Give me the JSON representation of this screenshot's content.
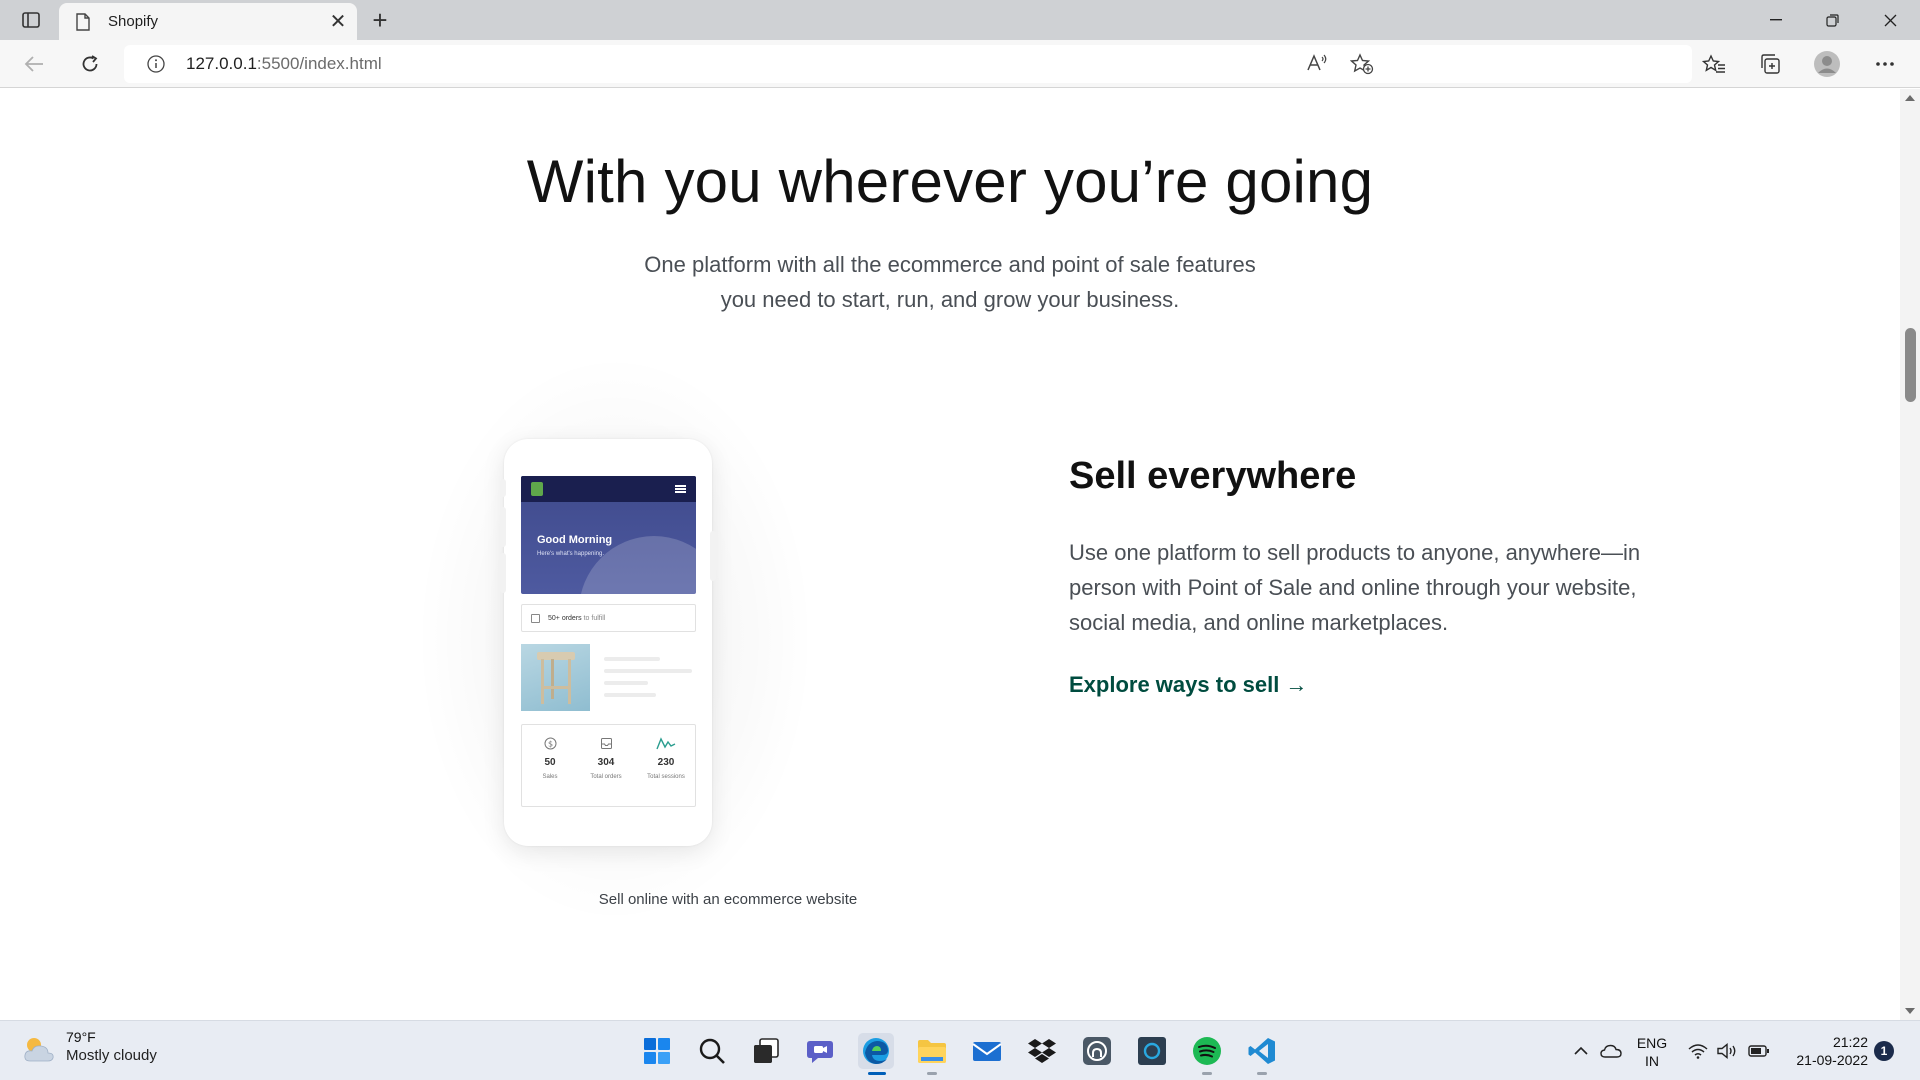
{
  "browser": {
    "tab_title": "Shopify",
    "url_host": "127.0.0.1",
    "url_rest": ":5500/index.html"
  },
  "page": {
    "hero_title": "With you wherever you’re going",
    "hero_sub_line1": "One platform with all the ecommerce and point of sale features",
    "hero_sub_line2": "you need to start, run, and grow your business.",
    "feature": {
      "title": "Sell everywhere",
      "body_line1": "Use one platform to sell products to anyone, anywhere—in",
      "body_line2": "person with Point of Sale and online through your website,",
      "body_line3": "social media, and online marketplaces.",
      "link": "Explore ways to sell",
      "link_arrow": "→",
      "link_color": "#004c3f"
    },
    "phone": {
      "greeting": "Good Morning",
      "greeting_sub": "Here's what's happening.",
      "orders_bold": "50+ orders",
      "orders_light": " to fulfill",
      "stats": [
        {
          "value": "50",
          "label": "Sales"
        },
        {
          "value": "304",
          "label": "Total orders"
        },
        {
          "value": "230",
          "label": "Total sessions"
        }
      ]
    },
    "caption": "Sell online with an ecommerce website"
  },
  "taskbar": {
    "weather_temp": "79°F",
    "weather_cond": "Mostly cloudy",
    "lang_line1": "ENG",
    "lang_line2": "IN",
    "time": "21:22",
    "date": "21-09-2022",
    "notifications": "1",
    "apps": [
      "start-icon",
      "search-icon",
      "task-view-icon",
      "teams-chat-icon",
      "edge-icon",
      "file-explorer-icon",
      "mail-icon",
      "dropbox-icon",
      "github-desktop-icon",
      "cortana-icon",
      "spotify-icon",
      "vscode-icon"
    ]
  }
}
